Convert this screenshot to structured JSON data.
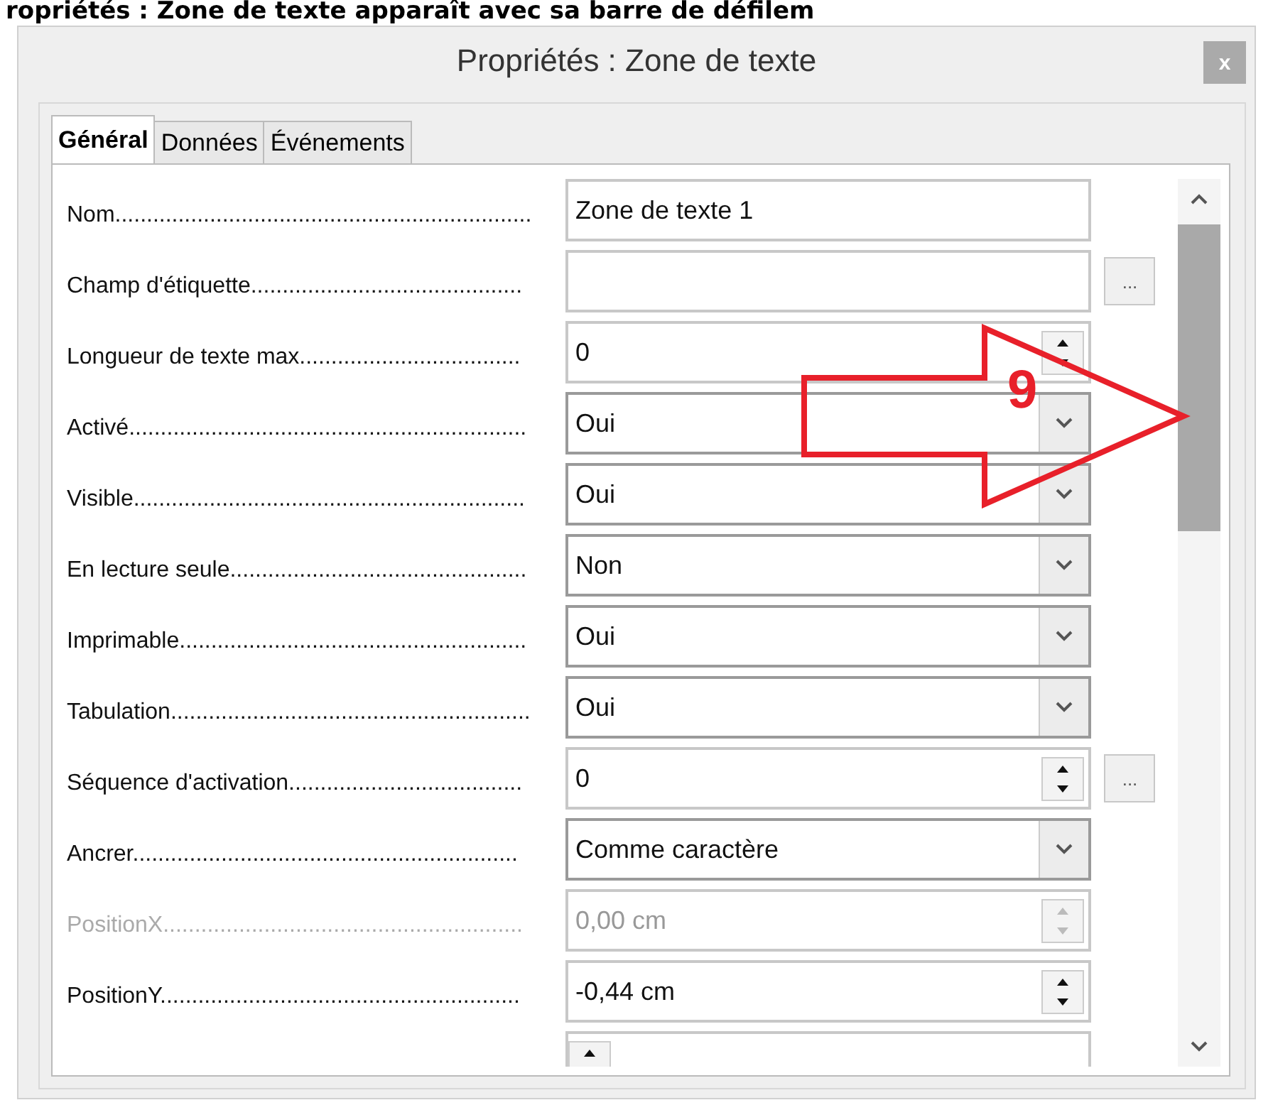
{
  "caption": "ropriétés : Zone de texte apparaît avec sa barre de défilem",
  "window": {
    "title": "Propriétés : Zone de texte",
    "close": "x"
  },
  "tabs": [
    {
      "label": "Général",
      "selected": true
    },
    {
      "label": "Données",
      "selected": false
    },
    {
      "label": "Événements",
      "selected": false
    }
  ],
  "properties": [
    {
      "label": "Nom..................................................................",
      "kind": "text",
      "value": "Zone de texte 1",
      "disabled": false
    },
    {
      "label": "Champ d'étiquette...........................................",
      "kind": "text",
      "browse": "...",
      "disabled": false
    },
    {
      "label": "Longueur de texte max...................................",
      "kind": "spin",
      "value": "0",
      "disabled": false
    },
    {
      "label": "Activé...............................................................",
      "kind": "combo",
      "value": "Oui",
      "disabled": false
    },
    {
      "label": "Visible..............................................................",
      "kind": "combo",
      "value": "Oui",
      "disabled": false
    },
    {
      "label": "En lecture seule...............................................",
      "kind": "combo",
      "value": "Non",
      "disabled": false
    },
    {
      "label": "Imprimable.......................................................",
      "kind": "combo",
      "value": "Oui",
      "disabled": false
    },
    {
      "label": "Tabulation.........................................................",
      "kind": "combo",
      "value": "Oui",
      "disabled": false
    },
    {
      "label": "Séquence d'activation.....................................",
      "kind": "spin",
      "value": "0",
      "browse": "...",
      "disabled": false
    },
    {
      "label": "Ancrer.............................................................",
      "kind": "combo",
      "value": "Comme caractère",
      "disabled": false
    },
    {
      "label": "PositionX.........................................................",
      "kind": "spin",
      "value": "0,00 cm",
      "disabled": true
    },
    {
      "label": "PositionY.........................................................",
      "kind": "spin",
      "value": "-0,44 cm",
      "disabled": false
    },
    {
      "kind": "spin"
    }
  ],
  "annotation": {
    "label": "9"
  }
}
